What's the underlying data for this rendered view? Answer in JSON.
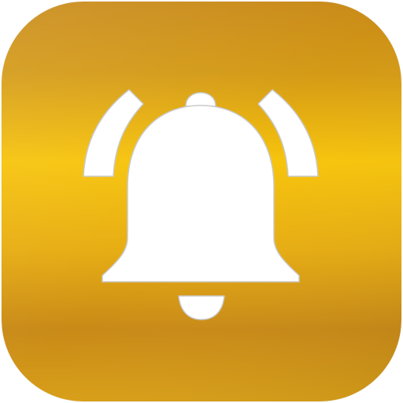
{
  "icon": {
    "name": "bell-notification-app-icon",
    "glyph": "bell-icon",
    "colors": {
      "gold_dark": "#c98a17",
      "gold_mid": "#e7ad12",
      "gold_bright": "#f7c40c",
      "gold_edge": "#d89f18",
      "glyph": "#ffffff",
      "glyph_outline": "#c9c9c9"
    }
  }
}
